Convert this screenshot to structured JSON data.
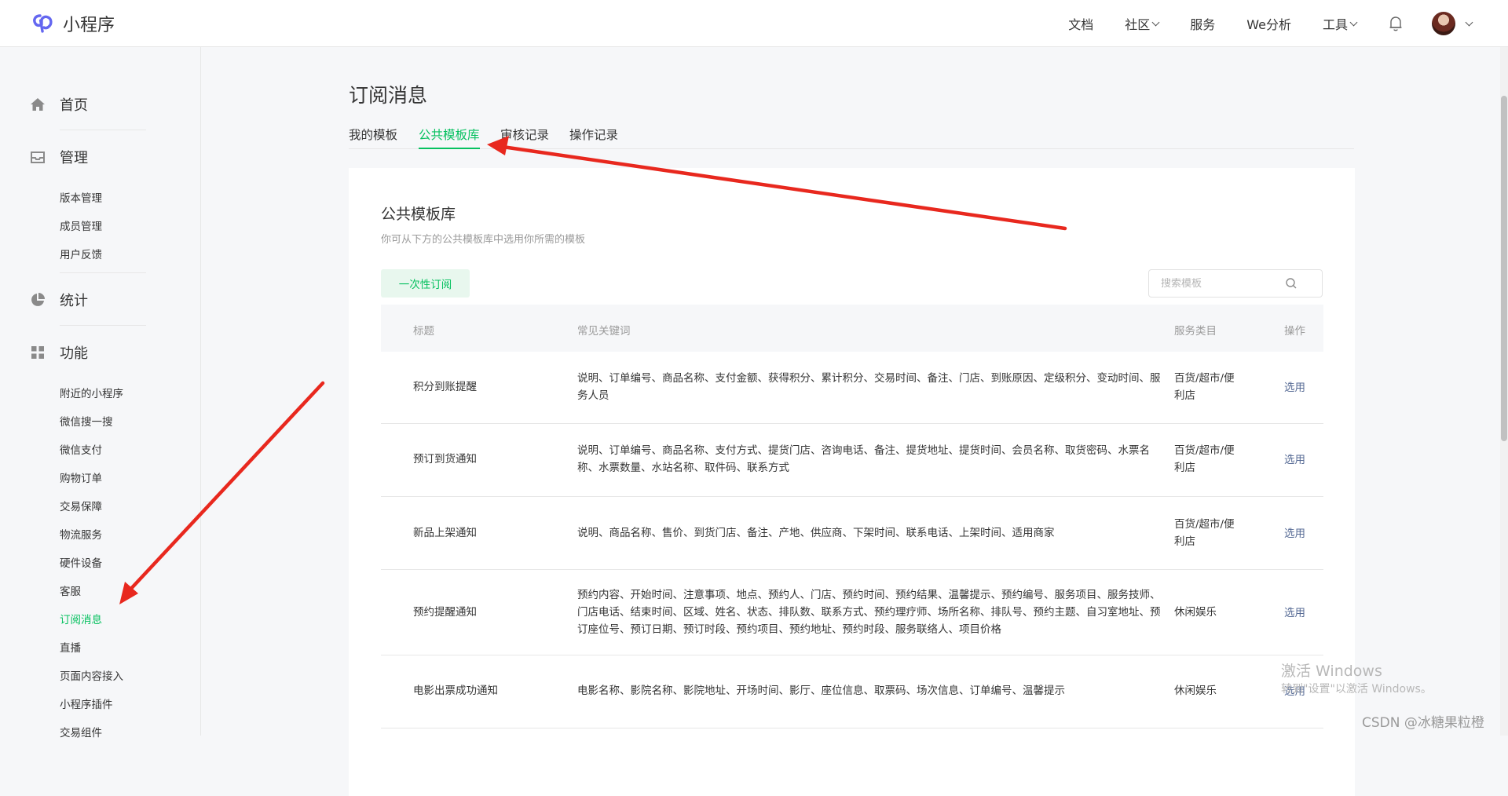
{
  "app": {
    "title": "小程序"
  },
  "topnav": {
    "items": [
      {
        "label": "文档"
      },
      {
        "label": "社区"
      },
      {
        "label": "服务"
      },
      {
        "label": "We分析"
      },
      {
        "label": "工具"
      }
    ]
  },
  "sidebar": {
    "groups": [
      {
        "label": "首页",
        "icon": "home-icon"
      },
      {
        "label": "管理",
        "icon": "inbox-icon",
        "items": [
          "版本管理",
          "成员管理",
          "用户反馈"
        ]
      },
      {
        "label": "统计",
        "icon": "pie-chart-icon"
      },
      {
        "label": "功能",
        "icon": "grid-icon",
        "items": [
          "附近的小程序",
          "微信搜一搜",
          "微信支付",
          "购物订单",
          "交易保障",
          "物流服务",
          "硬件设备",
          "客服",
          "订阅消息",
          "直播",
          "页面内容接入",
          "小程序插件",
          "交易组件"
        ]
      }
    ],
    "active": "订阅消息"
  },
  "page": {
    "title": "订阅消息",
    "tabs": [
      "我的模板",
      "公共模板库",
      "审核记录",
      "操作记录"
    ],
    "active_tab": "公共模板库"
  },
  "card": {
    "title": "公共模板库",
    "desc": "你可从下方的公共模板库中选用你所需的模板",
    "once_button": "一次性订阅",
    "search_placeholder": "搜索模板"
  },
  "table": {
    "headers": [
      "标题",
      "常见关键词",
      "服务类目",
      "操作"
    ],
    "rows": [
      {
        "title": "积分到账提醒",
        "keywords": "说明、订单编号、商品名称、支付金额、获得积分、累计积分、交易时间、备注、门店、到账原因、定级积分、变动时间、服务人员",
        "category": "百货/超市/便利店",
        "action": "选用"
      },
      {
        "title": "预订到货通知",
        "keywords": "说明、订单编号、商品名称、支付方式、提货门店、咨询电话、备注、提货地址、提货时间、会员名称、取货密码、水票名称、水票数量、水站名称、取件码、联系方式",
        "category": "百货/超市/便利店",
        "action": "选用"
      },
      {
        "title": "新品上架通知",
        "keywords": "说明、商品名称、售价、到货门店、备注、产地、供应商、下架时间、联系电话、上架时间、适用商家",
        "category": "百货/超市/便利店",
        "action": "选用"
      },
      {
        "title": "预约提醒通知",
        "keywords": "预约内容、开始时间、注意事项、地点、预约人、门店、预约时间、预约结果、温馨提示、预约编号、服务项目、服务技师、门店电话、结束时间、区域、姓名、状态、排队数、联系方式、预约理疗师、场所名称、排队号、预约主题、自习室地址、预订座位号、预订日期、预订时段、预约项目、预约地址、预约时段、服务联络人、项目价格",
        "category": "休闲娱乐",
        "action": "选用"
      },
      {
        "title": "电影出票成功通知",
        "keywords": "电影名称、影院名称、影院地址、开场时间、影厅、座位信息、取票码、场次信息、订单编号、温馨提示",
        "category": "休闲娱乐",
        "action": "选用"
      }
    ]
  },
  "watermark": {
    "line1": "激活 Windows",
    "line2": "转到\"设置\"以激活 Windows。",
    "csdn": "CSDN @冰糖果粒橙"
  },
  "colors": {
    "accent": "#07c160",
    "link": "#576b95",
    "annotation": "#e8281e"
  }
}
